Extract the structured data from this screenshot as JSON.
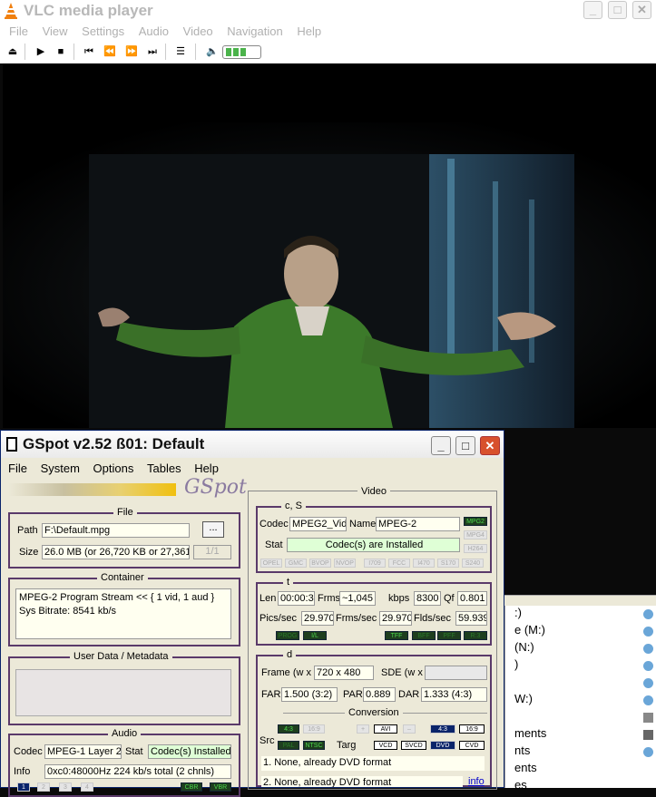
{
  "vlc": {
    "title": "VLC media player",
    "menu": [
      "File",
      "View",
      "Settings",
      "Audio",
      "Video",
      "Navigation",
      "Help"
    ]
  },
  "side": {
    "items": [
      ":)",
      "e (M:)",
      "(N:)",
      ")",
      "W:)",
      "ments",
      "nts",
      "ents",
      "es"
    ]
  },
  "gspot": {
    "title": "GSpot v2.52 ß01: Default",
    "menu": [
      "File",
      "System",
      "Options",
      "Tables",
      "Help"
    ],
    "logo": "GSpot",
    "file": {
      "title": "File",
      "path_label": "Path",
      "path": "F:\\Default.mpg",
      "size_label": "Size",
      "size": "26.0 MB (or 26,720 KB or 27,361,",
      "browse": "...",
      "page": "1/1"
    },
    "container": {
      "title": "Container",
      "line1": "MPEG-2 Program Stream << { 1 vid, 1 aud }",
      "line2": "Sys Bitrate: 8541 kb/s"
    },
    "userdata": {
      "title": "User Data / Metadata"
    },
    "audio": {
      "title": "Audio",
      "codec_label": "Codec",
      "codec": "MPEG-1 Layer 2",
      "stat_label": "Stat",
      "stat": "Codec(s) Installed",
      "info_label": "Info",
      "info": "0xc0:48000Hz  224 kb/s total (2 chnls)",
      "tabs": [
        "1",
        "2",
        "3",
        "4"
      ],
      "chips": [
        "CBR",
        "VBR"
      ]
    },
    "video": {
      "title": "Video",
      "cs": "c, S",
      "codec_label": "Codec",
      "codec": "MPEG2_Vid",
      "name_label": "Name",
      "name": "MPEG-2",
      "stat_label": "Stat",
      "stat": "Codec(s) are Installed",
      "fmt_chips": [
        "MPG2",
        "MPG4",
        "H264"
      ],
      "flag_chips": [
        "OPEL",
        "GMC",
        "BVOP",
        "NVOP",
        "I709",
        "FCC",
        "I470",
        "S170",
        "S240"
      ],
      "t": "t",
      "len_label": "Len",
      "len": "00:00:3",
      "frms_label": "Frms",
      "frms": "~1,045",
      "kbps_label": "kbps",
      "kbps": "8300",
      "qf_label": "Qf",
      "qf": "0.801",
      "pics_label": "Pics/sec",
      "pics": "29.970",
      "frmssec_label": "Frms/sec",
      "frmssec": "29.970",
      "flds_label": "Flds/sec",
      "flds": "59.939",
      "scan_chips": [
        "PROG",
        "I/L",
        "TFF",
        "BFF",
        "PFF",
        "R:3"
      ],
      "d": "d",
      "frame_label": "Frame (w x",
      "frame": "720 x 480",
      "sde_label": "SDE (w x",
      "far_label": "FAR",
      "far": "1.500 (3:2)",
      "par_label": "PAR",
      "par": "0.889",
      "dar_label": "DAR",
      "dar": "1.333 (4:3)",
      "conv_title": "Conversion",
      "src_label": "Src",
      "targ_label": "Targ",
      "src_chips": [
        "4:3",
        "16:9",
        "PAL",
        "NTSC"
      ],
      "targ_top": [
        "+",
        "AVI",
        "–",
        "4:3",
        "16:9"
      ],
      "targ_bot": [
        "VCD",
        "SVCD",
        "DVD",
        "CVD"
      ],
      "conv1": "1. None, already DVD format",
      "conv2": "2. None, already DVD format",
      "info_link": "info"
    }
  }
}
